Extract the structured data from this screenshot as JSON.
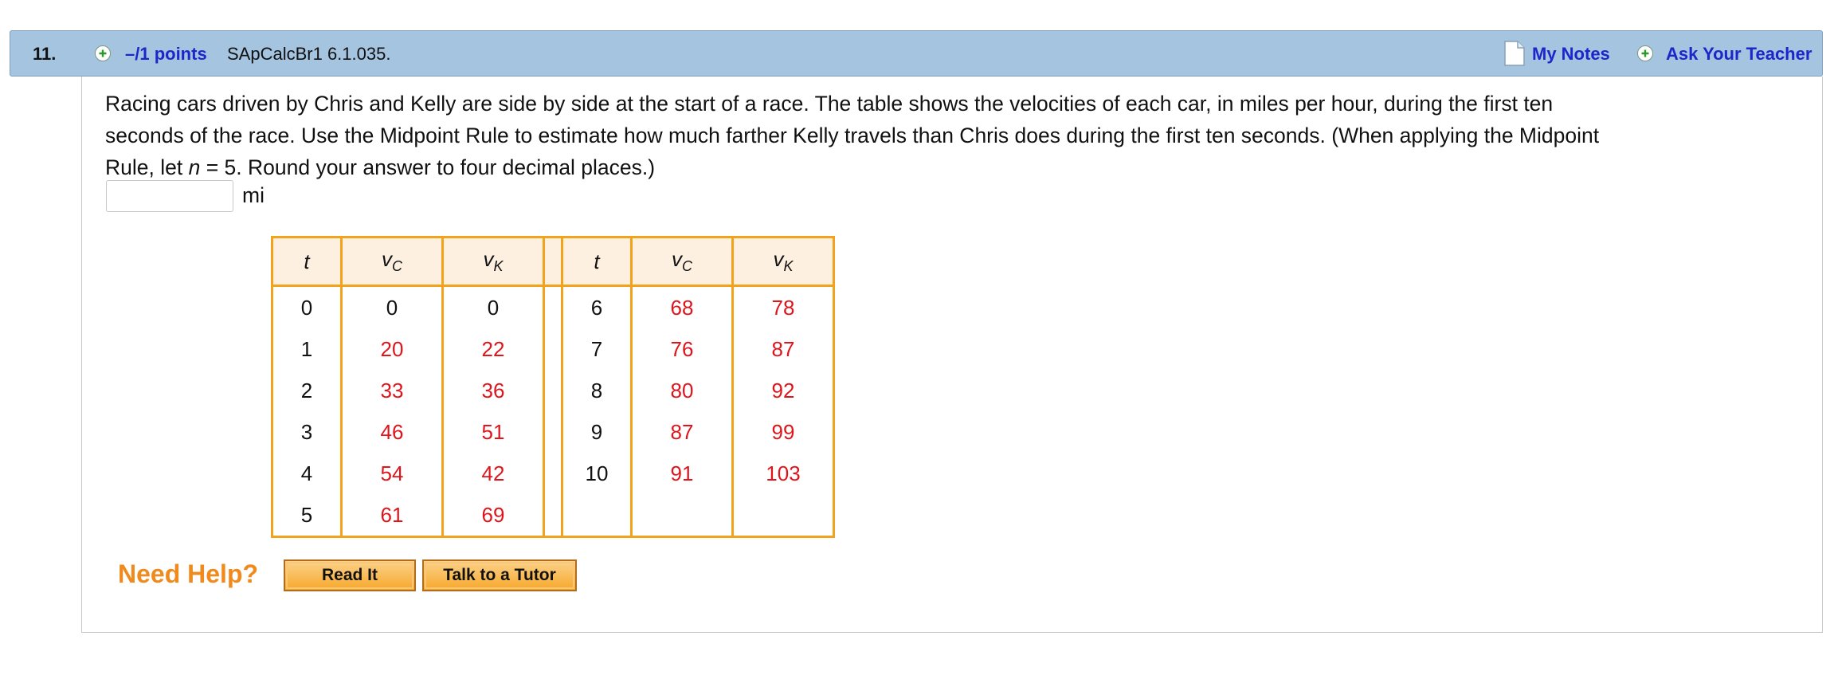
{
  "header": {
    "number": "11.",
    "points": "–/1 points",
    "source": "SApCalcBr1 6.1.035.",
    "my_notes": "My Notes",
    "ask_teacher": "Ask Your Teacher"
  },
  "question": {
    "line1": "Racing cars driven by Chris and Kelly are side by side at the start of a race. The table shows the velocities of each car, in miles per hour, during the first ten",
    "line2": "seconds of the race. Use the Midpoint Rule to estimate how much farther Kelly travels than Chris does during the first ten seconds. (When applying the Midpoint",
    "line3_pre": "Rule, let ",
    "line3_var": "n",
    "line3_post": " = 5. Round your answer to four decimal places.)"
  },
  "answer": {
    "value": "",
    "unit": "mi"
  },
  "table": {
    "headers": {
      "t": "t",
      "vc_main": "v",
      "vc_sub": "C",
      "vk_main": "v",
      "vk_sub": "K"
    },
    "left_rows": [
      {
        "t": "0",
        "vc": "0",
        "vk": "0"
      },
      {
        "t": "1",
        "vc": "20",
        "vk": "22"
      },
      {
        "t": "2",
        "vc": "33",
        "vk": "36"
      },
      {
        "t": "3",
        "vc": "46",
        "vk": "51"
      },
      {
        "t": "4",
        "vc": "54",
        "vk": "42"
      },
      {
        "t": "5",
        "vc": "61",
        "vk": "69"
      }
    ],
    "right_rows": [
      {
        "t": "6",
        "vc": "68",
        "vk": "78"
      },
      {
        "t": "7",
        "vc": "76",
        "vk": "87"
      },
      {
        "t": "8",
        "vc": "80",
        "vk": "92"
      },
      {
        "t": "9",
        "vc": "87",
        "vk": "99"
      },
      {
        "t": "10",
        "vc": "91",
        "vk": "103"
      },
      {
        "t": "",
        "vc": "",
        "vk": ""
      }
    ]
  },
  "help": {
    "label": "Need Help?",
    "read_it": "Read It",
    "talk_tutor": "Talk to a Tutor"
  },
  "colors": {
    "header_bg": "#a4c4e0",
    "link": "#1d27c9",
    "table_border": "#f2a21b",
    "value_red": "#e0141b",
    "need_help": "#f08a1c"
  },
  "icons": {
    "expand": "plus-circle-icon",
    "notes": "note-page-icon",
    "ask": "plus-circle-icon"
  }
}
